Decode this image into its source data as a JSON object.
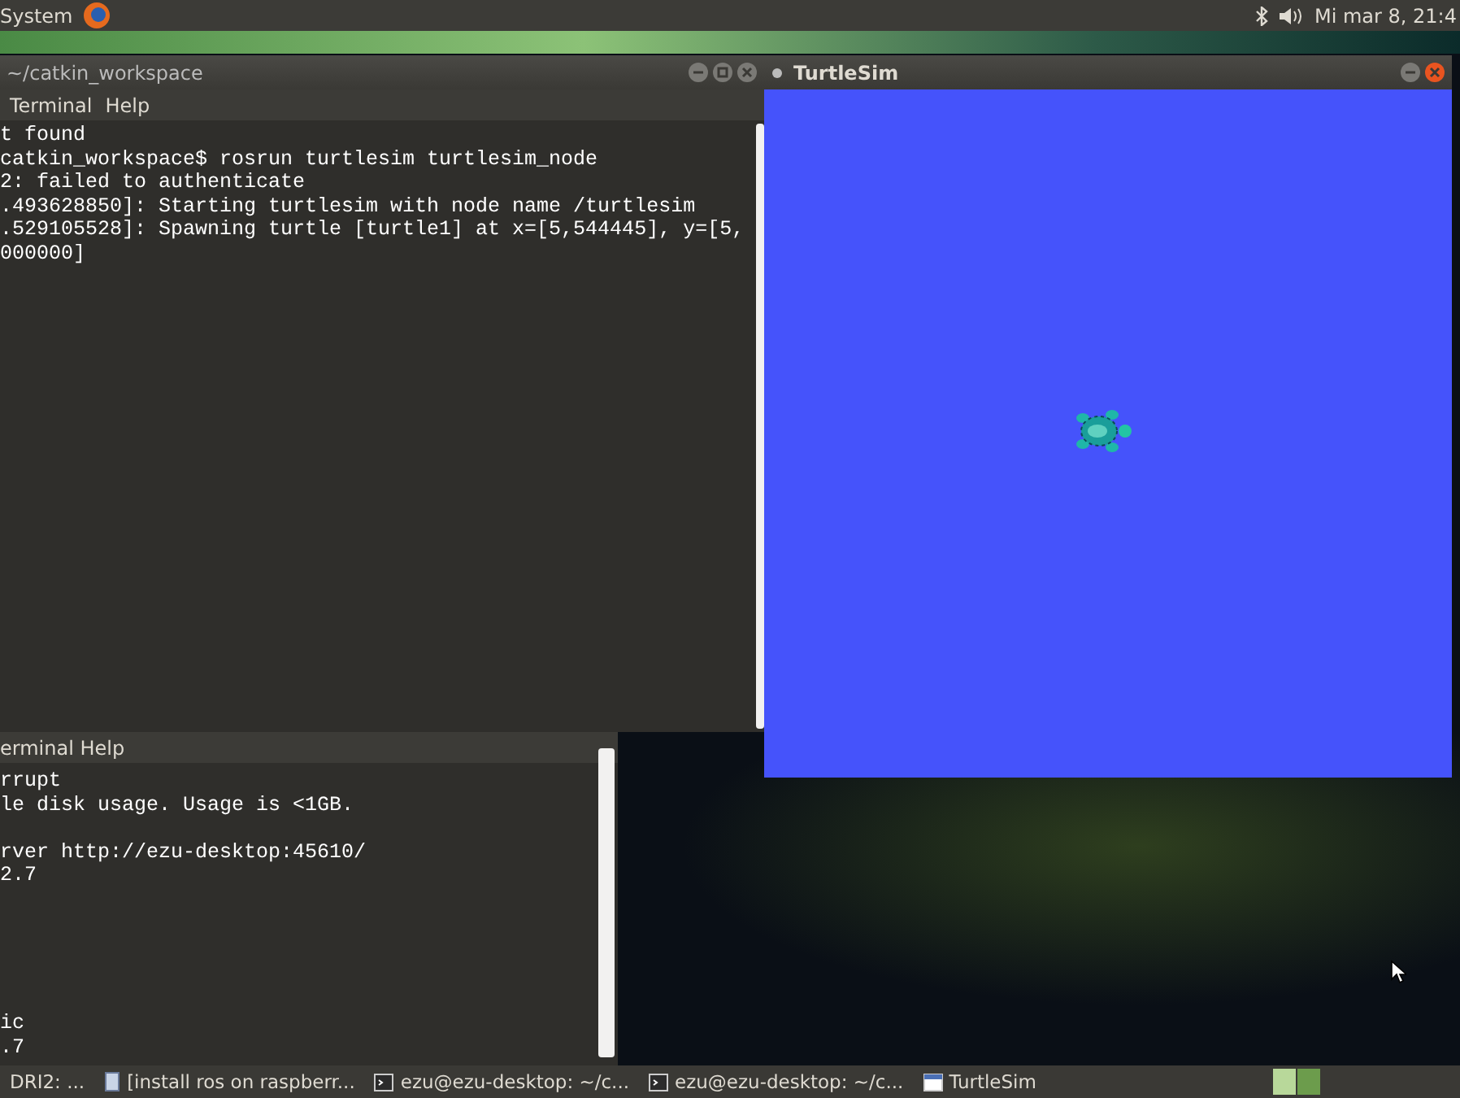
{
  "top_panel": {
    "menu": "System",
    "clock": "Mi mar 8, 21:4"
  },
  "terminal_front": {
    "title": "~/catkin_workspace",
    "menu": [
      "Terminal",
      "Help"
    ],
    "lines": [
      "t found",
      "catkin_workspace$ rosrun turtlesim turtlesim_node",
      "2: failed to authenticate",
      ".493628850]: Starting turtlesim with node name /turtlesim",
      ".529105528]: Spawning turtle [turtle1] at x=[5,544445], y=[5,",
      "000000]"
    ]
  },
  "terminal_back": {
    "menu": "erminal Help",
    "blocks": [
      [
        "rrupt",
        "le disk usage. Usage is <1GB."
      ],
      [
        "rver http://ezu-desktop:45610/",
        "2.7"
      ],
      [
        "ic",
        ".7"
      ]
    ]
  },
  "turtlesim": {
    "title": "TurtleSim"
  },
  "taskbar": {
    "items": [
      {
        "kind": "plain",
        "label": "DRI2: ..."
      },
      {
        "kind": "document",
        "label": "[install ros on raspberr..."
      },
      {
        "kind": "terminal",
        "label": "ezu@ezu-desktop: ~/c..."
      },
      {
        "kind": "terminal",
        "label": "ezu@ezu-desktop: ~/c..."
      },
      {
        "kind": "window",
        "label": "TurtleSim"
      }
    ]
  }
}
